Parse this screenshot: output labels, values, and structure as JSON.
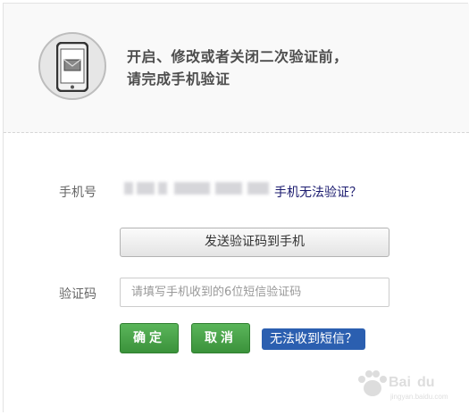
{
  "header": {
    "line1": "开启、修改或者关闭二次验证前，",
    "line2": "请完成手机验证"
  },
  "phone_row": {
    "label": "手机号",
    "link": "手机无法验证？"
  },
  "send_button": {
    "label": "发送验证码到手机"
  },
  "code_row": {
    "label": "验证码",
    "placeholder": "请填写手机收到的6位短信验证码"
  },
  "actions": {
    "confirm": "确定",
    "cancel": "取消",
    "no_sms": "无法收到短信？"
  },
  "watermark": {
    "text": "Baidu 经验",
    "sub": "jingyan.baidu.com"
  },
  "colors": {
    "green": "#46a546",
    "blue": "#2b5fb0",
    "link": "#1a1a6e"
  }
}
